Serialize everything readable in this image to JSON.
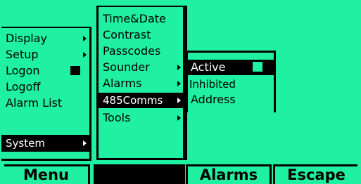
{
  "system_menu": {
    "items": [
      {
        "label": "Display",
        "has_submenu": true
      },
      {
        "label": "Setup",
        "has_submenu": true
      },
      {
        "label": "Logon",
        "has_submenu": false
      },
      {
        "label": "Logoff",
        "has_submenu": false
      },
      {
        "label": "Alarm List",
        "has_submenu": false
      }
    ],
    "selected": {
      "label": "System",
      "has_submenu": true
    }
  },
  "settings_menu": {
    "items": [
      {
        "label": "Time&Date",
        "has_submenu": false
      },
      {
        "label": "Contrast",
        "has_submenu": false
      },
      {
        "label": "Passcodes",
        "has_submenu": false
      },
      {
        "label": "Sounder",
        "has_submenu": true
      },
      {
        "label": "Alarms",
        "has_submenu": true
      },
      {
        "label": "485Comms",
        "has_submenu": true,
        "selected": true
      },
      {
        "label": "Tools",
        "has_submenu": true
      }
    ]
  },
  "comms_menu": {
    "items": [
      {
        "label": "Active",
        "selected": true
      },
      {
        "label": "Inhibited"
      },
      {
        "label": "Address"
      }
    ]
  },
  "softkeys": {
    "menu": "Menu",
    "blank": "",
    "alarms": "Alarms",
    "escape": "Escape"
  },
  "colors": {
    "background": "#1ff0a2",
    "foreground": "#000000"
  }
}
